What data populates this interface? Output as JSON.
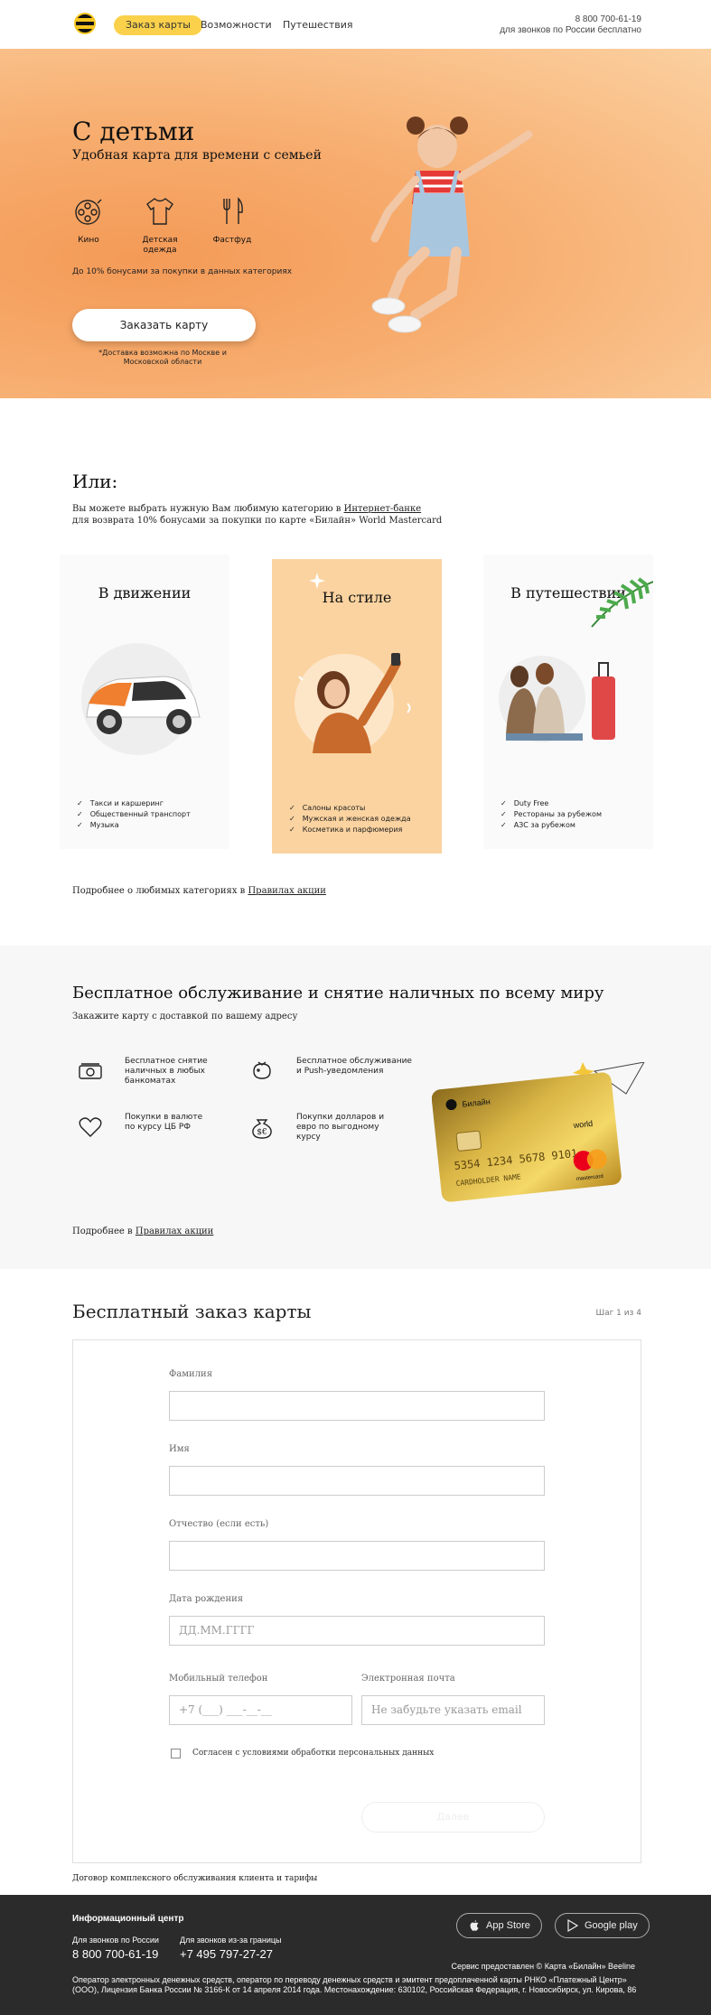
{
  "header": {
    "nav": [
      "Заказ карты",
      "Возможности",
      "Путешествия"
    ],
    "phone": "8 800 700-61-19",
    "phone_note": "для звонков по России бесплатно"
  },
  "hero": {
    "title": "С детьми",
    "subtitle": "Удобная карта для времени с семьей",
    "features": [
      {
        "icon": "film-reel-icon",
        "label": "Кино"
      },
      {
        "icon": "tshirt-icon",
        "label": "Детская одежда"
      },
      {
        "icon": "fork-knife-icon",
        "label": "Фастфуд"
      }
    ],
    "bonus": "До 10% бонусами за покупки в данных категориях",
    "button": "Заказать карту",
    "note": "*Доставка возможна по Москве и Московской области"
  },
  "or_section": {
    "title": "Или:",
    "text_line1_pre": "Вы можете выбрать нужную Вам любимую категорию в ",
    "text_line1_link": "Интернет-банке",
    "text_line2": "для возврата 10% бонусами за покупки по карте «Билайн» World Mastercard",
    "categories": [
      {
        "title": "В движении",
        "items": [
          "Такси и каршеринг",
          "Общественный транспорт",
          "Музыка"
        ]
      },
      {
        "title": "На стиле",
        "items": [
          "Салоны красоты",
          "Мужская и женская одежда",
          "Косметика и парфюмерия"
        ]
      },
      {
        "title": "В путешествии",
        "items": [
          "Duty Free",
          "Рестораны за рубежом",
          "АЗС за рубежом"
        ]
      }
    ],
    "more_pre": "Подробнее о любимых категориях в ",
    "more_link": "Правилах акции"
  },
  "service": {
    "title": "Бесплатное обслуживание и снятие наличных по всему миру",
    "subtitle": "Закажите карту с доставкой по вашему адресу",
    "items": [
      {
        "icon": "cash-icon",
        "text": "Бесплатное снятие наличных в любых банкоматах"
      },
      {
        "icon": "piggy-bank-icon",
        "text": "Бесплатное обслуживание и Push-уведомления"
      },
      {
        "icon": "heart-icon",
        "text": "Покупки в валюте по курсу ЦБ РФ"
      },
      {
        "icon": "dollar-bag-icon",
        "text": "Покупки долларов и евро по выгодному курсу"
      }
    ],
    "card": {
      "brand": "Билайн",
      "tier": "world",
      "number": "5354 1234 5678 9101",
      "holder": "CARDHOLDER NAME",
      "network": "mastercard"
    },
    "more_pre": "Подробнее в ",
    "more_link": "Правилах акции"
  },
  "form": {
    "title": "Бесплатный заказ карты",
    "step": "Шаг 1 из 4",
    "last_name_label": "Фамилия",
    "first_name_label": "Имя",
    "middle_name_label": "Отчество (если есть)",
    "birth_label": "Дата рождения",
    "birth_placeholder": "ДД.ММ.ГГГГ",
    "phone_label": "Мобильный телефон",
    "phone_placeholder": "+7 (___) ___-__-__",
    "email_label": "Электронная почта",
    "email_placeholder": "Не забудьте указать email",
    "consent": "Согласен с условиями обработки персональных данных",
    "next": "Далее",
    "contract": "Договор комплексного обслуживания клиента и тарифы"
  },
  "footer": {
    "title": "Информационный центр",
    "ru_label": "Для звонков по России",
    "ru_phone": "8 800 700-61-19",
    "abroad_label": "Для звонков из-за границы",
    "abroad_phone": "+7 495 797-27-27",
    "app_store": "App Store",
    "google_play": "Google play",
    "provider": "Сервис предоставлен © Карта «Билайн» Beeline",
    "legal": "Оператор электронных денежных средств, оператор по переводу денежных средств и эмитент предоплаченной карты РНКО «Платежный Центр» (ООО), Лицензия Банка России № 3166-К от 14 апреля 2014 года. Местонахождение: 630102, Российская Федерация, г. Новосибирск, ул. Кирова, 86"
  }
}
